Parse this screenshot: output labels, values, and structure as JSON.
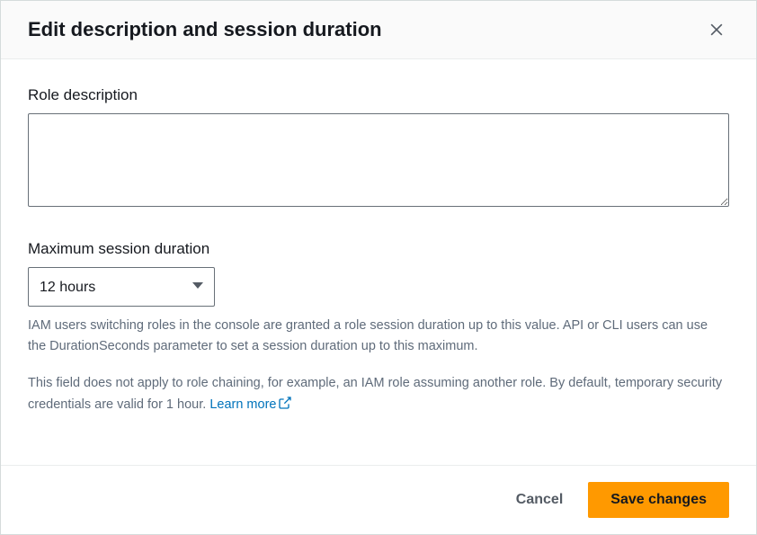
{
  "dialog": {
    "title": "Edit description and session duration"
  },
  "form": {
    "roleDescription": {
      "label": "Role description",
      "value": ""
    },
    "maxSessionDuration": {
      "label": "Maximum session duration",
      "selected": "12 hours",
      "help1": "IAM users switching roles in the console are granted a role session duration up to this value. API or CLI users can use the DurationSeconds parameter to set a session duration up to this maximum.",
      "help2": "This field does not apply to role chaining, for example, an IAM role assuming another role. By default, temporary security credentials are valid for 1 hour. ",
      "learnMore": "Learn more"
    }
  },
  "footer": {
    "cancel": "Cancel",
    "save": "Save changes"
  }
}
